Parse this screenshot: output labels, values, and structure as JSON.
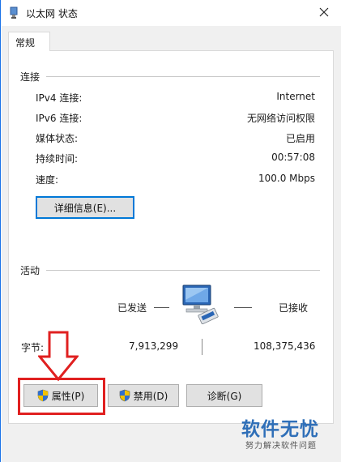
{
  "window": {
    "title": "以太网 状态"
  },
  "tabs": [
    {
      "label": "常规"
    }
  ],
  "connection": {
    "group_title": "连接",
    "rows": [
      {
        "label": "IPv4 连接:",
        "value": "Internet"
      },
      {
        "label": "IPv6 连接:",
        "value": "无网络访问权限"
      },
      {
        "label": "媒体状态:",
        "value": "已启用"
      },
      {
        "label": "持续时间:",
        "value": "00:57:08"
      },
      {
        "label": "速度:",
        "value": "100.0 Mbps"
      }
    ],
    "details_button": "详细信息(E)..."
  },
  "activity": {
    "group_title": "活动",
    "sent_label": "已发送",
    "received_label": "已接收",
    "bytes_label": "字节:",
    "bytes_sent": "7,913,299",
    "bytes_received": "108,375,436"
  },
  "buttons": {
    "properties": "属性(P)",
    "disable": "禁用(D)",
    "diagnose": "诊断(G)"
  },
  "watermark": {
    "main": "软件无忧",
    "sub": "努力解决软件问题"
  },
  "colors": {
    "annotation": "#e02020",
    "accent": "#0078d7",
    "watermark": "#2f6fb8"
  }
}
